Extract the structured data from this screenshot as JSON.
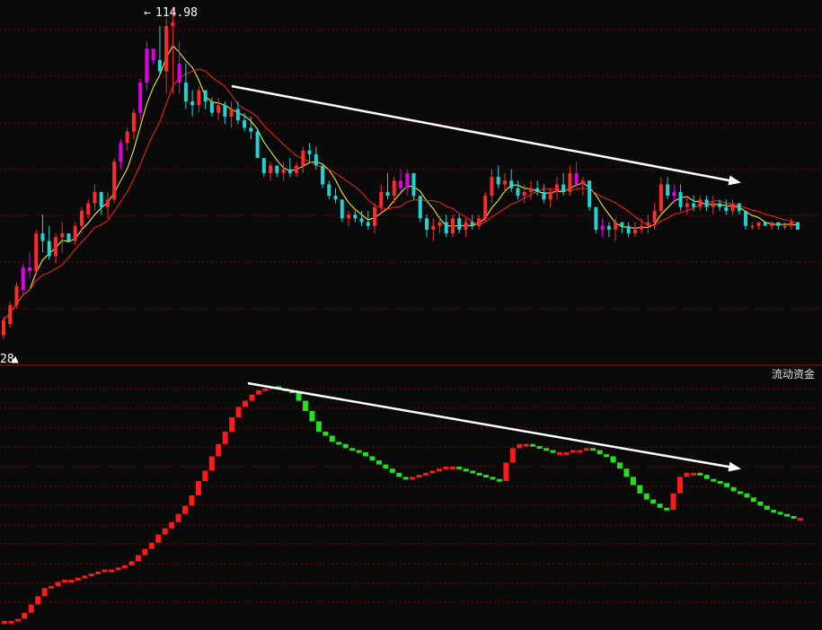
{
  "chart_data": [
    {
      "type": "candlestick",
      "annotations": {
        "high_label": "114.98",
        "low_label": "28",
        "trend_arrow": "down"
      },
      "colors": {
        "up": "#ff2a2a",
        "down": "#22d3d3",
        "limit_up": "#e000e0",
        "ma_short": "#ffff33",
        "ma_long": "#ff2020",
        "grid": "#8b0000",
        "arrow": "#ffffff"
      },
      "candles": [
        [
          28,
          33,
          27,
          32
        ],
        [
          31,
          37,
          30,
          36
        ],
        [
          36,
          42,
          35,
          41
        ],
        [
          40,
          47,
          39,
          46
        ],
        [
          46,
          50,
          43,
          45
        ],
        [
          45,
          56,
          44,
          55
        ],
        [
          55,
          60,
          50,
          53
        ],
        [
          53,
          57,
          48,
          49
        ],
        [
          49,
          55,
          47,
          54
        ],
        [
          54,
          58,
          50,
          55
        ],
        [
          55,
          54,
          55,
          53
        ],
        [
          53,
          58,
          52,
          57
        ],
        [
          57,
          62,
          55,
          61
        ],
        [
          60,
          64,
          59,
          63
        ],
        [
          63,
          68,
          61,
          66
        ],
        [
          66,
          65,
          60,
          62
        ],
        [
          62,
          66,
          59,
          64
        ],
        [
          64,
          75,
          63,
          74
        ],
        [
          74,
          80,
          72,
          79
        ],
        [
          79,
          83,
          77,
          82
        ],
        [
          82,
          88,
          80,
          87
        ],
        [
          87,
          96,
          85,
          95
        ],
        [
          95,
          106,
          93,
          104
        ],
        [
          104,
          102,
          100,
          101
        ],
        [
          101,
          110,
          97,
          98
        ],
        [
          98,
          112,
          92,
          110
        ],
        [
          110,
          114.98,
          92,
          111
        ],
        [
          100,
          106,
          92,
          95
        ],
        [
          95,
          100,
          88,
          90
        ],
        [
          90,
          93,
          86,
          89
        ],
        [
          89,
          94,
          87,
          93
        ],
        [
          93,
          92,
          88,
          90
        ],
        [
          90,
          91,
          86,
          87
        ],
        [
          87,
          91,
          85,
          89
        ],
        [
          89,
          90,
          84,
          86
        ],
        [
          86,
          90,
          83,
          88
        ],
        [
          88,
          90,
          84,
          85
        ],
        [
          85,
          87,
          82,
          83
        ],
        [
          83,
          86,
          80,
          82
        ],
        [
          82,
          83,
          75,
          75
        ],
        [
          75,
          73,
          70,
          71
        ],
        [
          71,
          74,
          69,
          73
        ],
        [
          73,
          72,
          70,
          71
        ],
        [
          71,
          74,
          69,
          72
        ],
        [
          72,
          75,
          70,
          71
        ],
        [
          71,
          74,
          70,
          73
        ],
        [
          73,
          78,
          71,
          77
        ],
        [
          77,
          79,
          74,
          76
        ],
        [
          76,
          78,
          72,
          73
        ],
        [
          73,
          72,
          67,
          68
        ],
        [
          68,
          69,
          64,
          65
        ],
        [
          65,
          67,
          63,
          64
        ],
        [
          64,
          61,
          58,
          59
        ],
        [
          59,
          61,
          57,
          60
        ],
        [
          60,
          61,
          58,
          59
        ],
        [
          59,
          61,
          57,
          58
        ],
        [
          58,
          61,
          56,
          57
        ],
        [
          57,
          63,
          55,
          62
        ],
        [
          62,
          68,
          60,
          66
        ],
        [
          66,
          71,
          64,
          65
        ],
        [
          65,
          70,
          63,
          69
        ],
        [
          69,
          72,
          66,
          67
        ],
        [
          67,
          72,
          65,
          71
        ],
        [
          71,
          70,
          64,
          65
        ],
        [
          65,
          64,
          58,
          59
        ],
        [
          59,
          60,
          54,
          56
        ],
        [
          56,
          59,
          53,
          57
        ],
        [
          57,
          59,
          55,
          58
        ],
        [
          58,
          60,
          54,
          55
        ],
        [
          55,
          60,
          54,
          59
        ],
        [
          59,
          60,
          55,
          56
        ],
        [
          56,
          59,
          54,
          58
        ],
        [
          58,
          60,
          56,
          57
        ],
        [
          57,
          60,
          56,
          59
        ],
        [
          59,
          66,
          58,
          65
        ],
        [
          65,
          72,
          63,
          70
        ],
        [
          70,
          73,
          67,
          68
        ],
        [
          68,
          71,
          66,
          69
        ],
        [
          69,
          72,
          66,
          67
        ],
        [
          67,
          69,
          64,
          65
        ],
        [
          65,
          68,
          63,
          66
        ],
        [
          66,
          69,
          64,
          67
        ],
        [
          67,
          69,
          65,
          66
        ],
        [
          66,
          68,
          63,
          64
        ],
        [
          64,
          67,
          62,
          66
        ],
        [
          66,
          70,
          64,
          68
        ],
        [
          68,
          71,
          65,
          66
        ],
        [
          66,
          73,
          65,
          71
        ],
        [
          71,
          74,
          67,
          68
        ],
        [
          68,
          70,
          65,
          69
        ],
        [
          69,
          68,
          61,
          62
        ],
        [
          62,
          61,
          55,
          56
        ],
        [
          56,
          59,
          54,
          57
        ],
        [
          57,
          58,
          54,
          56
        ],
        [
          56,
          59,
          53,
          58
        ],
        [
          58,
          58,
          55,
          57
        ],
        [
          57,
          58,
          54,
          55
        ],
        [
          55,
          58,
          54,
          56
        ],
        [
          56,
          59,
          55,
          57
        ],
        [
          57,
          60,
          55,
          58
        ],
        [
          58,
          63,
          56,
          61
        ],
        [
          61,
          70,
          60,
          68
        ],
        [
          68,
          70,
          64,
          65
        ],
        [
          65,
          68,
          63,
          66
        ],
        [
          66,
          68,
          61,
          62
        ],
        [
          62,
          65,
          60,
          63
        ],
        [
          63,
          65,
          61,
          62
        ],
        [
          62,
          65,
          61,
          64
        ],
        [
          64,
          65,
          61,
          62
        ],
        [
          62,
          65,
          60,
          63
        ],
        [
          63,
          64,
          61,
          62
        ],
        [
          62,
          64,
          60,
          61
        ],
        [
          61,
          64,
          60,
          63
        ],
        [
          63,
          62,
          60,
          61
        ],
        [
          61,
          57,
          56,
          57
        ],
        [
          57,
          58,
          56,
          57
        ],
        [
          57,
          58,
          56,
          58
        ],
        [
          58,
          58,
          57,
          57
        ],
        [
          57,
          58,
          56,
          58
        ],
        [
          58,
          58,
          56,
          57
        ],
        [
          57,
          58,
          56,
          57
        ],
        [
          57,
          59,
          56,
          58
        ],
        [
          58,
          58,
          56,
          56
        ]
      ],
      "limit_up_index": [
        3,
        4,
        18,
        21,
        22,
        23,
        27,
        61,
        62,
        88,
        92,
        103
      ]
    },
    {
      "type": "step",
      "title": "流动资金",
      "colors": {
        "rise": "#ff1a1a",
        "fall": "#22e022",
        "arrow": "#ffffff"
      },
      "values": [
        2,
        2,
        3,
        6,
        10,
        14,
        18,
        19,
        21,
        22,
        22,
        23,
        24,
        25,
        26,
        27,
        27,
        28,
        29,
        31,
        34,
        37,
        40,
        44,
        47,
        50,
        54,
        58,
        63,
        70,
        75,
        82,
        88,
        94,
        101,
        106,
        109,
        112,
        114,
        115,
        116,
        115,
        114,
        113,
        109,
        104,
        99,
        94,
        92,
        89,
        88,
        86,
        85,
        84,
        82,
        80,
        78,
        76,
        74,
        72,
        71,
        72,
        73,
        74,
        75,
        76,
        77,
        77,
        76,
        75,
        74,
        73,
        72,
        71,
        70,
        79,
        86,
        88,
        88,
        87,
        86,
        85,
        84,
        84,
        84,
        85,
        85,
        86,
        85,
        83,
        82,
        79,
        76,
        72,
        68,
        64,
        61,
        59,
        57,
        56,
        64,
        72,
        74,
        74,
        73,
        71,
        70,
        69,
        67,
        65,
        64,
        62,
        60,
        58,
        56,
        55,
        54,
        53,
        52,
        52
      ]
    }
  ]
}
